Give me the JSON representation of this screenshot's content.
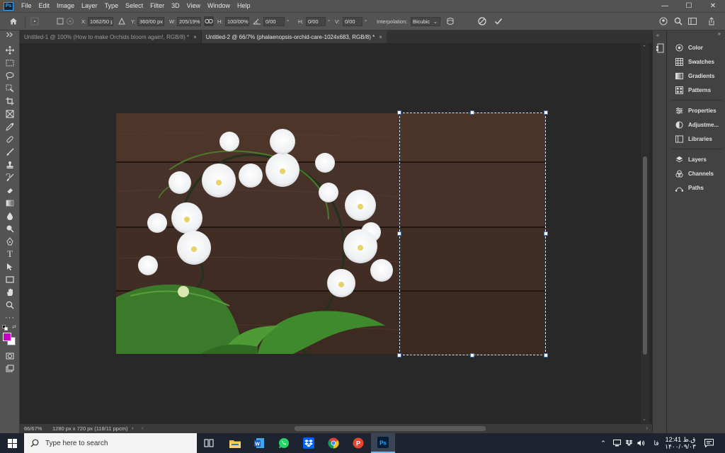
{
  "app": {
    "logo_text": "Ps"
  },
  "menu": [
    "File",
    "Edit",
    "Image",
    "Layer",
    "Type",
    "Select",
    "Filter",
    "3D",
    "View",
    "Window",
    "Help"
  ],
  "window_controls": {
    "minimize": "—",
    "maximize": "☐",
    "close": "✕"
  },
  "options": {
    "x_label": "X:",
    "x_value": "1062/50 px",
    "y_label": "Y:",
    "y_value": "360/00 px",
    "w_label": "W:",
    "w_value": "205/19%",
    "h_label": "H:",
    "h_value": "100/00%",
    "angle_value": "0/00",
    "angle_unit": "°",
    "hskew_label": "H:",
    "hskew_value": "0/00",
    "hskew_unit": "°",
    "vskew_label": "V:",
    "vskew_value": "0/00",
    "vskew_unit": "°",
    "interp_label": "Interpolation:",
    "interp_value": "Bicubic"
  },
  "tabs": [
    {
      "label": "Untitled-1 @ 100% (How to make Orchids bloom again!, RGB/8) *",
      "active": false
    },
    {
      "label": "Untitled-2 @ 66/7% (phalaenopsis-orchid-care-1024x683, RGB/8) *",
      "active": true
    }
  ],
  "tab_close": "×",
  "colors": {
    "foreground": "#c800c8",
    "background": "#ffffff",
    "accent": "#31a8ff"
  },
  "panels": [
    {
      "label": "Color",
      "icon": "color-wheel-icon"
    },
    {
      "label": "Swatches",
      "icon": "swatches-icon"
    },
    {
      "label": "Gradients",
      "icon": "gradients-icon"
    },
    {
      "label": "Patterns",
      "icon": "patterns-icon"
    },
    {
      "label": "Properties",
      "icon": "properties-icon"
    },
    {
      "label": "Adjustme...",
      "icon": "adjustments-icon"
    },
    {
      "label": "Libraries",
      "icon": "libraries-icon"
    },
    {
      "label": "Layers",
      "icon": "layers-icon"
    },
    {
      "label": "Channels",
      "icon": "channels-icon"
    },
    {
      "label": "Paths",
      "icon": "paths-icon"
    }
  ],
  "status": {
    "zoom": "66/67%",
    "doc_size": "1280 px x 720 px (118/11 ppcm)"
  },
  "taskbar": {
    "search_placeholder": "Type here to search",
    "lang": "فا",
    "time": "12:41 ق.ظ",
    "date": "۱۴۰۰/۰۹/۰۳"
  }
}
